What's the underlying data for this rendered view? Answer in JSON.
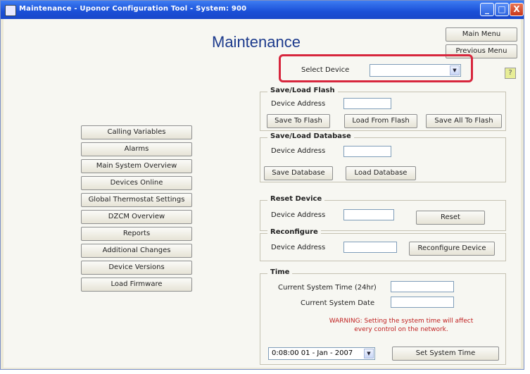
{
  "window": {
    "title": "Maintenance - Uponor Configuration Tool - System: 900",
    "controls": {
      "minimize": "_",
      "maximize": "□",
      "close": "X"
    }
  },
  "heading": "Maintenance",
  "nav": {
    "main_menu": "Main Menu",
    "previous_menu": "Previous Menu"
  },
  "select_device": {
    "label": "Select Device",
    "value": ""
  },
  "left_menu": [
    "Calling Variables",
    "Alarms",
    "Main System Overview",
    "Devices Online",
    "Global Thermostat Settings",
    "DZCM Overview",
    "Reports",
    "Additional Changes",
    "Device Versions",
    "Load Firmware"
  ],
  "flash": {
    "title": "Save/Load Flash",
    "address_label": "Device Address",
    "save": "Save To Flash",
    "load": "Load From Flash",
    "save_all": "Save All To Flash"
  },
  "database": {
    "title": "Save/Load Database",
    "address_label": "Device Address",
    "save": "Save Database",
    "load": "Load Database"
  },
  "reset": {
    "title": "Reset Device",
    "address_label": "Device Address",
    "button": "Reset"
  },
  "reconfigure": {
    "title": "Reconfigure",
    "address_label": "Device Address",
    "button": "Reconfigure Device"
  },
  "time": {
    "title": "Time",
    "current_time_label": "Current System Time (24hr)",
    "current_date_label": "Current System Date",
    "warning_line1": "WARNING: Setting the system time will affect",
    "warning_line2": "every control on the network.",
    "picker_value": "0:08:00 01 - Jan - 2007",
    "set_button": "Set System Time"
  },
  "help_icon_glyph": "?",
  "colors": {
    "accent_highlight": "#d7263d",
    "heading": "#1c3a8c",
    "warning": "#c02020",
    "titlebar": "#1a4fd7"
  }
}
